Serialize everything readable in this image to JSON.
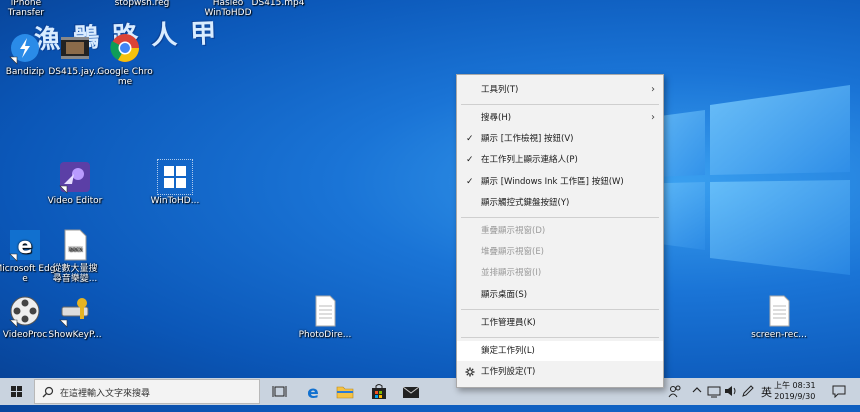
{
  "watermark": "漁 鶻 路 人 甲",
  "desktop": {
    "top_labels": [
      "iPhone\nTransfer",
      "stopwsh.reg",
      "Hasleo\nWinToHDD",
      "DS415.mp4"
    ],
    "icons": [
      {
        "label": "Bandizip",
        "icon": "bandizip-icon"
      },
      {
        "label": "DS415.jay...",
        "icon": "video-thumb-icon"
      },
      {
        "label": "Google Chrome",
        "icon": "chrome-icon"
      },
      {
        "label": "Video Editor",
        "icon": "video-editor-icon"
      },
      {
        "label": "WinToHD...",
        "icon": "wintohdd-icon"
      },
      {
        "label": "Microsoft Edge",
        "icon": "edge-icon"
      },
      {
        "label": "從數大量搜\n尋音樂變...",
        "icon": "docx-icon"
      },
      {
        "label": "VideoProc",
        "icon": "videoproc-icon"
      },
      {
        "label": "ShowKeyP...",
        "icon": "showkeyplus-icon"
      },
      {
        "label": "PhotoDire...",
        "icon": "file-icon"
      },
      {
        "label": "screen-rec...",
        "icon": "file-icon"
      }
    ]
  },
  "context_menu": {
    "toolbars": "工具列(T)",
    "search": "搜尋(H)",
    "show_taskview": "顯示 [工作檢視] 按鈕(V)",
    "show_people": "在工作列上顯示連絡人(P)",
    "show_ink": "顯示 [Windows Ink 工作區] 按鈕(W)",
    "show_touch_kb": "顯示觸控式鍵盤按鈕(Y)",
    "cascade": "重疊顯示視窗(D)",
    "stacked": "堆疊顯示視窗(E)",
    "side_by_side": "並排顯示視窗(I)",
    "show_desktop": "顯示桌面(S)",
    "task_manager": "工作管理員(K)",
    "lock_taskbar": "鎖定工作列(L)",
    "taskbar_settings": "工作列設定(T)",
    "check": "✓",
    "arrow": "›"
  },
  "taskbar": {
    "search_placeholder": "在這裡輸入文字來搜尋",
    "ime": "英",
    "time": "上午 08:31",
    "date": "2019/9/30"
  },
  "colors": {
    "accent": "#0078d7",
    "taskbar_bg": "#c9d3df"
  }
}
